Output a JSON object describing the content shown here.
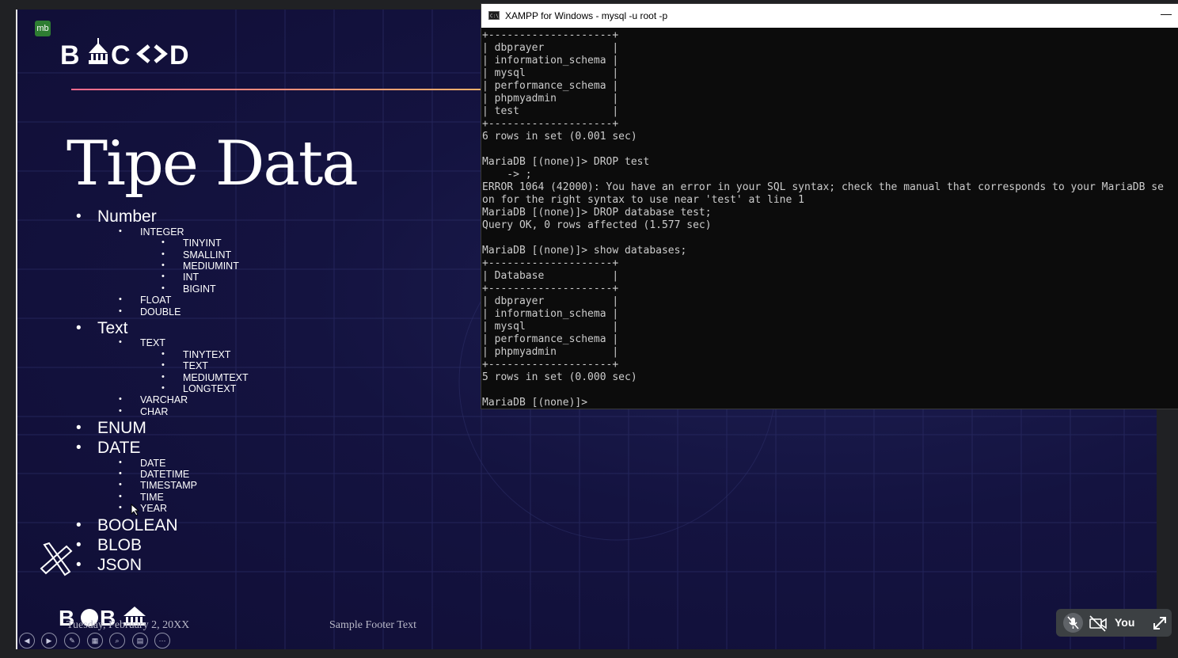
{
  "slide": {
    "app_badge": "mb",
    "logo_top": "BACOD",
    "title": "Tipe Data",
    "bullets": {
      "number": "Number",
      "integer": "INTEGER",
      "tinyint": "TINYINT",
      "smallint": "SMALLINT",
      "mediumint": "MEDIUMINT",
      "int": "INT",
      "bigint": "BIGINT",
      "float": "FLOAT",
      "double": "DOUBLE",
      "text": "Text",
      "text_sub": "TEXT",
      "tinytext": "TINYTEXT",
      "text_type": "TEXT",
      "mediumtext": "MEDIUMTEXT",
      "longtext": "LONGTEXT",
      "varchar": "VARCHAR",
      "char": "CHAR",
      "enum": "ENUM",
      "date": "DATE",
      "date_type": "DATE",
      "datetime": "DATETIME",
      "timestamp": "TIMESTAMP",
      "time": "TIME",
      "year": "YEAR",
      "boolean": "BOOLEAN",
      "blob": "BLOB",
      "json": "JSON"
    },
    "logo_bottom": "BOBA",
    "footer_date": "Tuesday, February 2, 20XX",
    "footer_text": "Sample Footer Text",
    "controls": [
      "prev-icon",
      "next-icon",
      "pen-icon",
      "slides-icon",
      "zoom-icon",
      "subtitles-icon",
      "more-icon"
    ]
  },
  "terminal": {
    "title": "XAMPP for Windows - mysql  -u root -p",
    "minimize": "—",
    "output": "+--------------------+\n| dbprayer           |\n| information_schema |\n| mysql              |\n| performance_schema |\n| phpmyadmin         |\n| test               |\n+--------------------+\n6 rows in set (0.001 sec)\n\nMariaDB [(none)]> DROP test\n    -> ;\nERROR 1064 (42000): You have an error in your SQL syntax; check the manual that corresponds to your MariaDB se\non for the right syntax to use near 'test' at line 1\nMariaDB [(none)]> DROP database test;\nQuery OK, 0 rows affected (1.577 sec)\n\nMariaDB [(none)]> show databases;\n+--------------------+\n| Database           |\n+--------------------+\n| dbprayer           |\n| information_schema |\n| mysql              |\n| performance_schema |\n| phpmyadmin         |\n+--------------------+\n5 rows in set (0.000 sec)\n\nMariaDB [(none)]>"
  },
  "meeting": {
    "mic_icon": "mic-off-icon",
    "camera_icon": "camera-off-icon",
    "you_label": "You",
    "expand_icon": "expand-icon"
  }
}
